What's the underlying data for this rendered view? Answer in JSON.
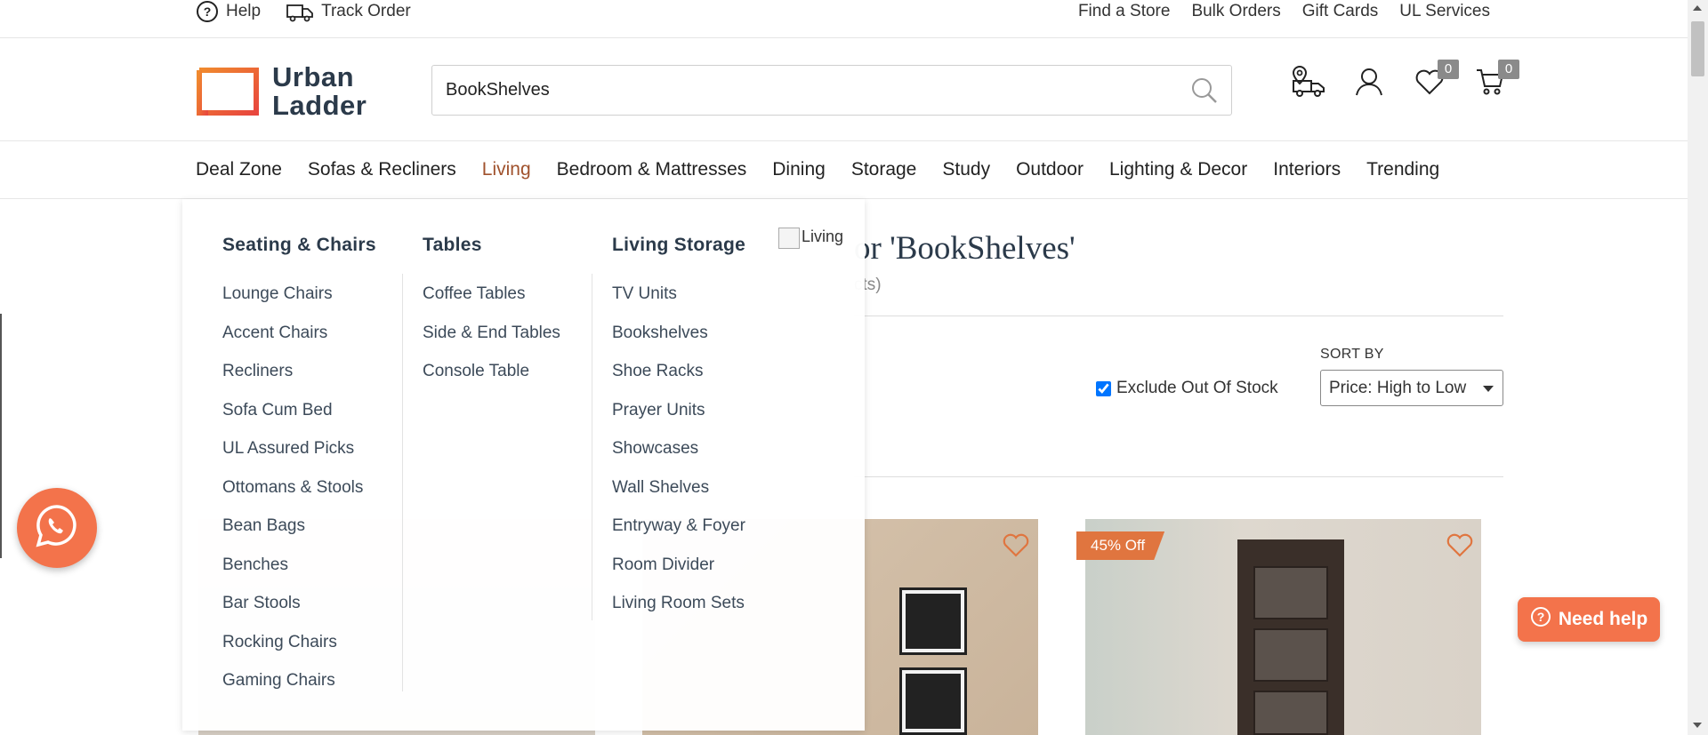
{
  "topbar": {
    "help": "Help",
    "track_order": "Track Order",
    "links": [
      "Find a Store",
      "Bulk Orders",
      "Gift Cards",
      "UL Services"
    ]
  },
  "header": {
    "logo_line1": "Urban",
    "logo_line2": "Ladder",
    "search_value": "BookShelves",
    "wishlist_count": "0",
    "cart_count": "0"
  },
  "nav": {
    "items": [
      "Deal Zone",
      "Sofas & Recliners",
      "Living",
      "Bedroom & Mattresses",
      "Dining",
      "Storage",
      "Study",
      "Outdoor",
      "Lighting & Decor",
      "Interiors",
      "Trending"
    ],
    "active": "Living"
  },
  "mega_menu": {
    "columns": [
      {
        "heading": "Seating & Chairs",
        "items": [
          "Lounge Chairs",
          "Accent Chairs",
          "Recliners",
          "Sofa Cum Bed",
          "UL Assured Picks",
          "Ottomans & Stools",
          "Bean Bags",
          "Benches",
          "Bar Stools",
          "Rocking Chairs",
          "Gaming Chairs"
        ]
      },
      {
        "heading": "Tables",
        "items": [
          "Coffee Tables",
          "Side & End Tables",
          "Console Table"
        ]
      },
      {
        "heading": "Living Storage",
        "items": [
          "TV Units",
          "Bookshelves",
          "Shoe Racks",
          "Prayer Units",
          "Showcases",
          "Wall Shelves",
          "Entryway & Foyer",
          "Room Divider",
          "Living Room Sets"
        ]
      }
    ],
    "image_alt": "Living"
  },
  "results": {
    "title_visible": "or 'BookShelves'",
    "count_visible": "cts)"
  },
  "filters": {
    "exclude_oos_label": "Exclude Out Of Stock",
    "exclude_oos_checked": true,
    "sort_label": "SORT BY",
    "sort_value": "Price: High to Low"
  },
  "products": [
    {
      "discount": "45% Off"
    }
  ],
  "need_help": "Need help",
  "colors": {
    "accent": "#f3734b",
    "active_nav": "#a0522d",
    "heading": "#2b3a4a"
  }
}
